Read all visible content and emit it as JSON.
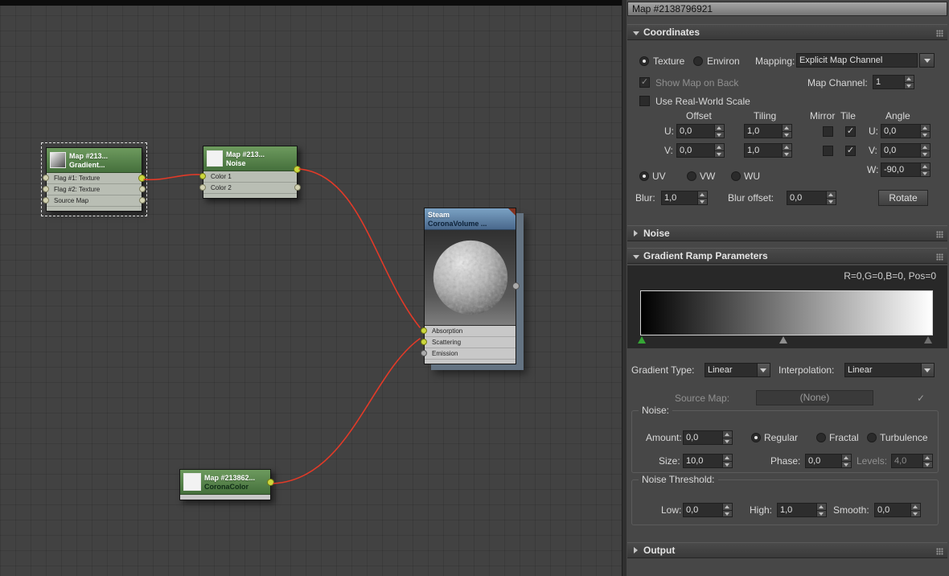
{
  "window": {
    "title": "Map #2138796921"
  },
  "colors": {
    "wire": "#e23a28",
    "node_green": "#5d8a52",
    "node_blue": "#5f83a6",
    "selected_flag": "#35a635"
  },
  "rollouts": {
    "coordinates": "Coordinates",
    "noise": "Noise",
    "gradient_ramp": "Gradient Ramp Parameters",
    "output": "Output"
  },
  "coordinates": {
    "texture": "Texture",
    "environ": "Environ",
    "mapping_label": "Mapping:",
    "mapping_value": "Explicit Map Channel",
    "show_map_on_back": "Show Map on Back",
    "map_channel_label": "Map Channel:",
    "map_channel_value": "1",
    "use_real_world_scale": "Use Real-World Scale",
    "offset_header": "Offset",
    "tiling_header": "Tiling",
    "mirror_header": "Mirror",
    "tile_header": "Tile",
    "angle_header": "Angle",
    "u_label": "U:",
    "v_label": "V:",
    "w_label": "W:",
    "u_offset": "0,0",
    "u_tiling": "1,0",
    "u_angle": "0,0",
    "v_offset": "0,0",
    "v_tiling": "1,0",
    "v_angle": "0,0",
    "w_angle": "-90,0",
    "uv": "UV",
    "vw": "VW",
    "wu": "WU",
    "blur_label": "Blur:",
    "blur_value": "1,0",
    "blur_offset_label": "Blur offset:",
    "blur_offset_value": "0,0",
    "rotate": "Rotate"
  },
  "gradient_ramp": {
    "flag_info": "R=0,G=0,B=0, Pos=0",
    "gradient_type_label": "Gradient Type:",
    "gradient_type_value": "Linear",
    "interpolation_label": "Interpolation:",
    "interpolation_value": "Linear",
    "source_map_label": "Source Map:",
    "source_map_value": "(None)",
    "noise": {
      "title": "Noise:",
      "amount_label": "Amount:",
      "amount_value": "0,0",
      "regular": "Regular",
      "fractal": "Fractal",
      "turbulence": "Turbulence",
      "size_label": "Size:",
      "size_value": "10,0",
      "phase_label": "Phase:",
      "phase_value": "0,0",
      "levels_label": "Levels:",
      "levels_value": "4,0"
    },
    "threshold": {
      "title": "Noise Threshold:",
      "low_label": "Low:",
      "low_value": "0,0",
      "high_label": "High:",
      "high_value": "1,0",
      "smooth_label": "Smooth:",
      "smooth_value": "0,0"
    }
  },
  "nodes": {
    "gradient": {
      "title": "Map #213...",
      "subtitle": "Gradient...",
      "slots": [
        "Flag #1: Texture",
        "Flag #2: Texture",
        "Source Map"
      ]
    },
    "noise": {
      "title": "Map #213...",
      "subtitle": "Noise",
      "slots": [
        "Color 1",
        "Color 2"
      ]
    },
    "volume": {
      "title": "Steam",
      "subtitle": "CoronaVolume ...",
      "slots": [
        "Absorption",
        "Scattering",
        "Emission"
      ]
    },
    "corona_color": {
      "title": "Map #213862...",
      "subtitle": "CoronaColor"
    }
  }
}
